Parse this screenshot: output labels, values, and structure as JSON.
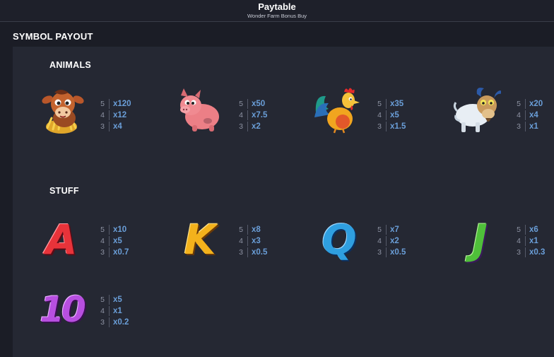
{
  "header": {
    "title": "Paytable",
    "subtitle": "Wonder Farm Bonus Buy"
  },
  "section": {
    "title": "SYMBOL PAYOUT"
  },
  "groups": {
    "animals": {
      "title": "ANIMALS",
      "symbols": [
        {
          "icon": "cow-icon",
          "payouts": [
            {
              "count": "5",
              "mult": "x120"
            },
            {
              "count": "4",
              "mult": "x12"
            },
            {
              "count": "3",
              "mult": "x4"
            }
          ]
        },
        {
          "icon": "pig-icon",
          "payouts": [
            {
              "count": "5",
              "mult": "x50"
            },
            {
              "count": "4",
              "mult": "x7.5"
            },
            {
              "count": "3",
              "mult": "x2"
            }
          ]
        },
        {
          "icon": "rooster-icon",
          "payouts": [
            {
              "count": "5",
              "mult": "x35"
            },
            {
              "count": "4",
              "mult": "x5"
            },
            {
              "count": "3",
              "mult": "x1.5"
            }
          ]
        },
        {
          "icon": "goat-icon",
          "payouts": [
            {
              "count": "5",
              "mult": "x20"
            },
            {
              "count": "4",
              "mult": "x4"
            },
            {
              "count": "3",
              "mult": "x1"
            }
          ]
        }
      ]
    },
    "stuff": {
      "title": "STUFF",
      "symbols": [
        {
          "icon": "letter-a-icon",
          "glyph": "A",
          "color": "#e8333a",
          "payouts": [
            {
              "count": "5",
              "mult": "x10"
            },
            {
              "count": "4",
              "mult": "x5"
            },
            {
              "count": "3",
              "mult": "x0.7"
            }
          ]
        },
        {
          "icon": "letter-k-icon",
          "glyph": "K",
          "color": "#f3b21c",
          "payouts": [
            {
              "count": "5",
              "mult": "x8"
            },
            {
              "count": "4",
              "mult": "x3"
            },
            {
              "count": "3",
              "mult": "x0.5"
            }
          ]
        },
        {
          "icon": "letter-q-icon",
          "glyph": "Q",
          "color": "#2f9fe0",
          "payouts": [
            {
              "count": "5",
              "mult": "x7"
            },
            {
              "count": "4",
              "mult": "x2"
            },
            {
              "count": "3",
              "mult": "x0.5"
            }
          ]
        },
        {
          "icon": "letter-j-icon",
          "glyph": "J",
          "color": "#4fbf3a",
          "payouts": [
            {
              "count": "5",
              "mult": "x6"
            },
            {
              "count": "4",
              "mult": "x1"
            },
            {
              "count": "3",
              "mult": "x0.3"
            }
          ]
        },
        {
          "icon": "number-10-icon",
          "glyph": "10",
          "color": "#b84fe0",
          "payouts": [
            {
              "count": "5",
              "mult": "x5"
            },
            {
              "count": "4",
              "mult": "x1"
            },
            {
              "count": "3",
              "mult": "x0.2"
            }
          ]
        }
      ]
    }
  }
}
